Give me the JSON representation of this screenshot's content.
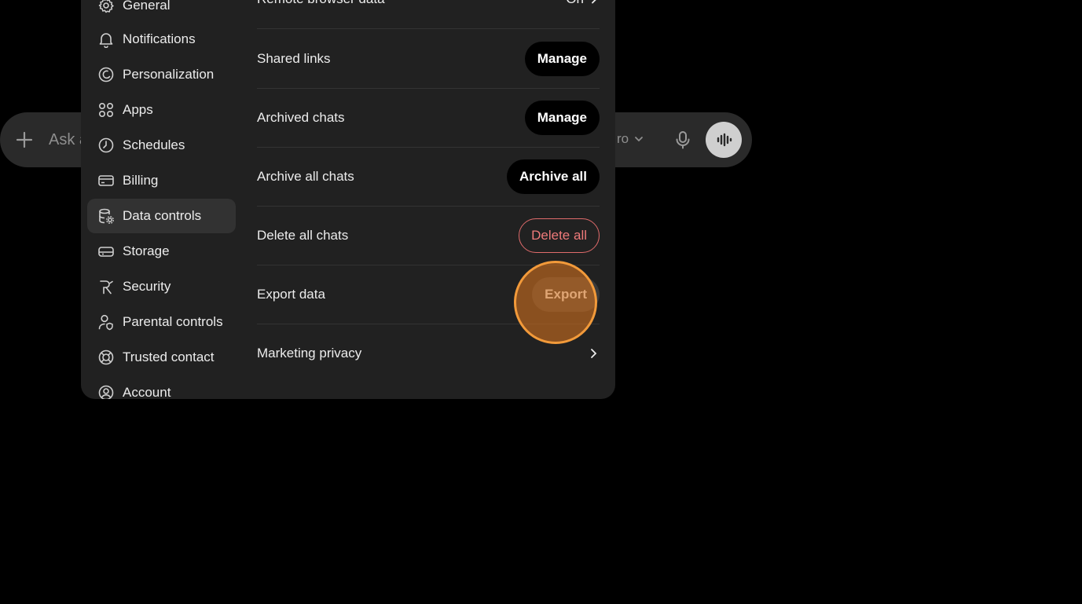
{
  "composer": {
    "placeholder": "Ask a",
    "model_label": "ro"
  },
  "sidebar": {
    "items": [
      {
        "label": "General",
        "icon": "gear-icon"
      },
      {
        "label": "Notifications",
        "icon": "bell-icon"
      },
      {
        "label": "Personalization",
        "icon": "personalization-icon"
      },
      {
        "label": "Apps",
        "icon": "apps-grid-icon"
      },
      {
        "label": "Schedules",
        "icon": "clock-icon"
      },
      {
        "label": "Billing",
        "icon": "credit-card-icon"
      },
      {
        "label": "Data controls",
        "icon": "database-gear-icon",
        "active": true
      },
      {
        "label": "Storage",
        "icon": "storage-drive-icon"
      },
      {
        "label": "Security",
        "icon": "shield-lock-icon"
      },
      {
        "label": "Parental controls",
        "icon": "person-shield-icon"
      },
      {
        "label": "Trusted contact",
        "icon": "lifebuoy-icon"
      },
      {
        "label": "Account",
        "icon": "user-circle-icon"
      }
    ]
  },
  "settings": {
    "remote_browser": {
      "label": "Remote browser data",
      "value": "On"
    },
    "shared_links": {
      "label": "Shared links",
      "button": "Manage"
    },
    "archived_chats": {
      "label": "Archived chats",
      "button": "Manage"
    },
    "archive_all": {
      "label": "Archive all chats",
      "button": "Archive all"
    },
    "delete_all": {
      "label": "Delete all chats",
      "button": "Delete all"
    },
    "export": {
      "label": "Export data",
      "button": "Export"
    },
    "marketing": {
      "label": "Marketing privacy"
    }
  },
  "colors": {
    "background": "#000000",
    "modal": "#212121",
    "active_item": "#323232",
    "danger": "#ef7a7a",
    "click_indicator": "#f29a3a"
  }
}
